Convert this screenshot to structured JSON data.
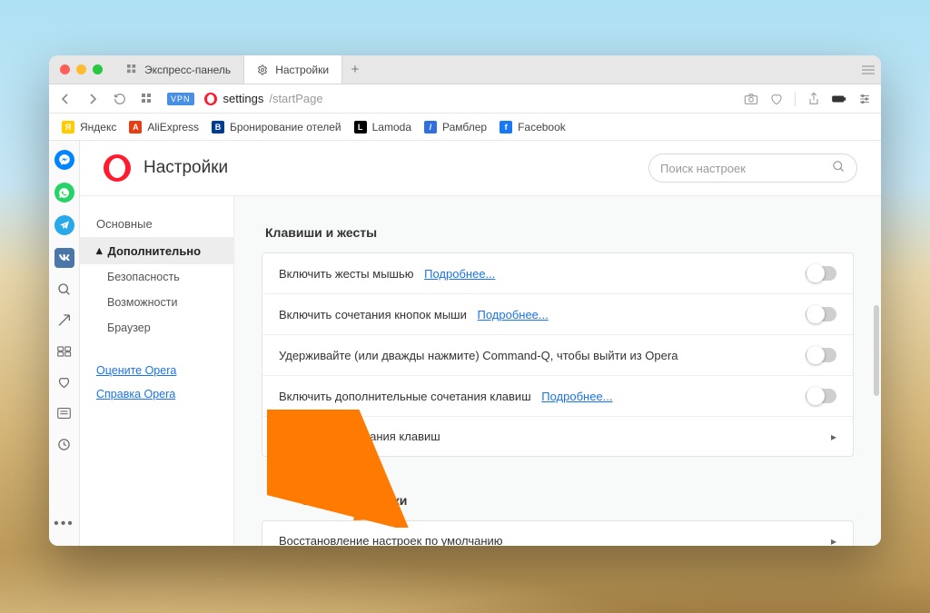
{
  "traffic": {
    "colors": [
      "#ff5f57",
      "#febc2e",
      "#28c840"
    ]
  },
  "tabs": [
    {
      "label": "Экспресс-панель",
      "active": false
    },
    {
      "label": "Настройки",
      "active": true
    }
  ],
  "address": {
    "vpn": "VPN",
    "host": "settings",
    "path": "/startPage"
  },
  "bookmarks": [
    {
      "label": "Яндекс",
      "bg": "#ffcc00",
      "glyph": "Я"
    },
    {
      "label": "AliExpress",
      "bg": "#e43e12",
      "glyph": "A"
    },
    {
      "label": "Бронирование отелей",
      "bg": "#003b95",
      "glyph": "B"
    },
    {
      "label": "Lamoda",
      "bg": "#000000",
      "glyph": "L"
    },
    {
      "label": "Рамблер",
      "bg": "#2f6fe0",
      "glyph": "/"
    },
    {
      "label": "Facebook",
      "bg": "#1877f2",
      "glyph": "f"
    }
  ],
  "dock": {
    "messenger_color": "#0084ff",
    "whatsapp_color": "#25d366",
    "telegram_color": "#29a9ea",
    "vk_color": "#4a76a8"
  },
  "page_title": "Настройки",
  "search_placeholder": "Поиск настроек",
  "sidenav": {
    "basic": "Основные",
    "advanced": "Дополнительно",
    "security": "Безопасность",
    "features": "Возможности",
    "browser": "Браузер",
    "rate": "Оцените Opera",
    "help": "Справка Opera"
  },
  "sections": {
    "keys_title": "Клавиши и жесты",
    "rows": {
      "mouse_gestures": "Включить жесты мышью",
      "rocker": "Включить сочетания кнопок мыши",
      "commandq": "Удерживайте (или дважды нажмите) Command-Q, чтобы выйти из Opera",
      "extra_shortcuts": "Включить дополнительные сочетания клавиш",
      "configure": "Настроить сочетания клавиш"
    },
    "more": "Подробнее...",
    "reset_title": "осить настройки",
    "reset_row": "Восстановление настроек по умолчанию"
  }
}
